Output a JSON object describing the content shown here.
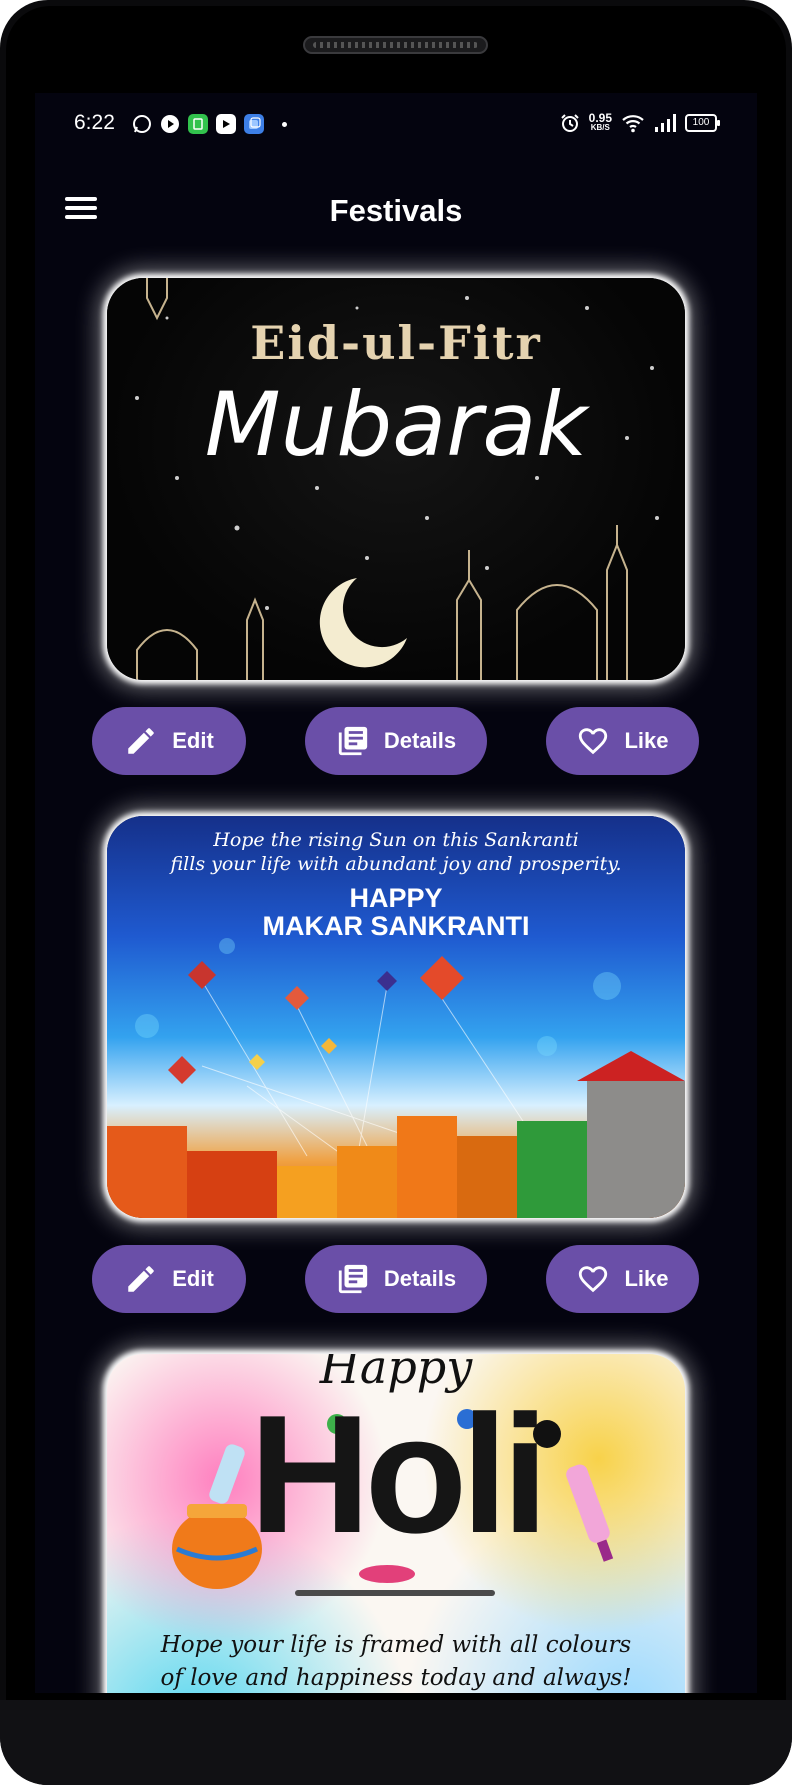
{
  "status_bar": {
    "time": "6:22",
    "net_speed_value": "0.95",
    "net_speed_unit": "KB/S",
    "battery": "100",
    "left_icons": [
      "whatsapp-icon",
      "play-icon",
      "app-icon",
      "youtube-icon",
      "files-icon",
      "dot-icon"
    ],
    "right_icons": [
      "alarm-icon",
      "wifi-icon",
      "signal-icon",
      "battery-icon"
    ]
  },
  "app_bar": {
    "title": "Festivals",
    "menu_icon": "hamburger-menu-icon"
  },
  "cards": [
    {
      "image_text_line1": "Eid-ul-Fitr",
      "image_text_line2": "Mubarak",
      "actions": {
        "edit": "Edit",
        "details": "Details",
        "like": "Like"
      }
    },
    {
      "image_text_line1": "Hope the rising Sun on this Sankranti",
      "image_text_line2": "fills your life with abundant joy and prosperity.",
      "image_text_line3": "HAPPY",
      "image_text_line4": "MAKAR SANKRANTI",
      "actions": {
        "edit": "Edit",
        "details": "Details",
        "like": "Like"
      }
    },
    {
      "image_text_line1": "Happy",
      "image_text_line2": "Holi",
      "image_text_line3": "Hope your life is framed with all colours",
      "image_text_line4": "of love and happiness today and always!"
    }
  ],
  "colors": {
    "button_bg": "#6a4fa8",
    "screen_bg": "#04040f",
    "text": "#ffffff"
  }
}
